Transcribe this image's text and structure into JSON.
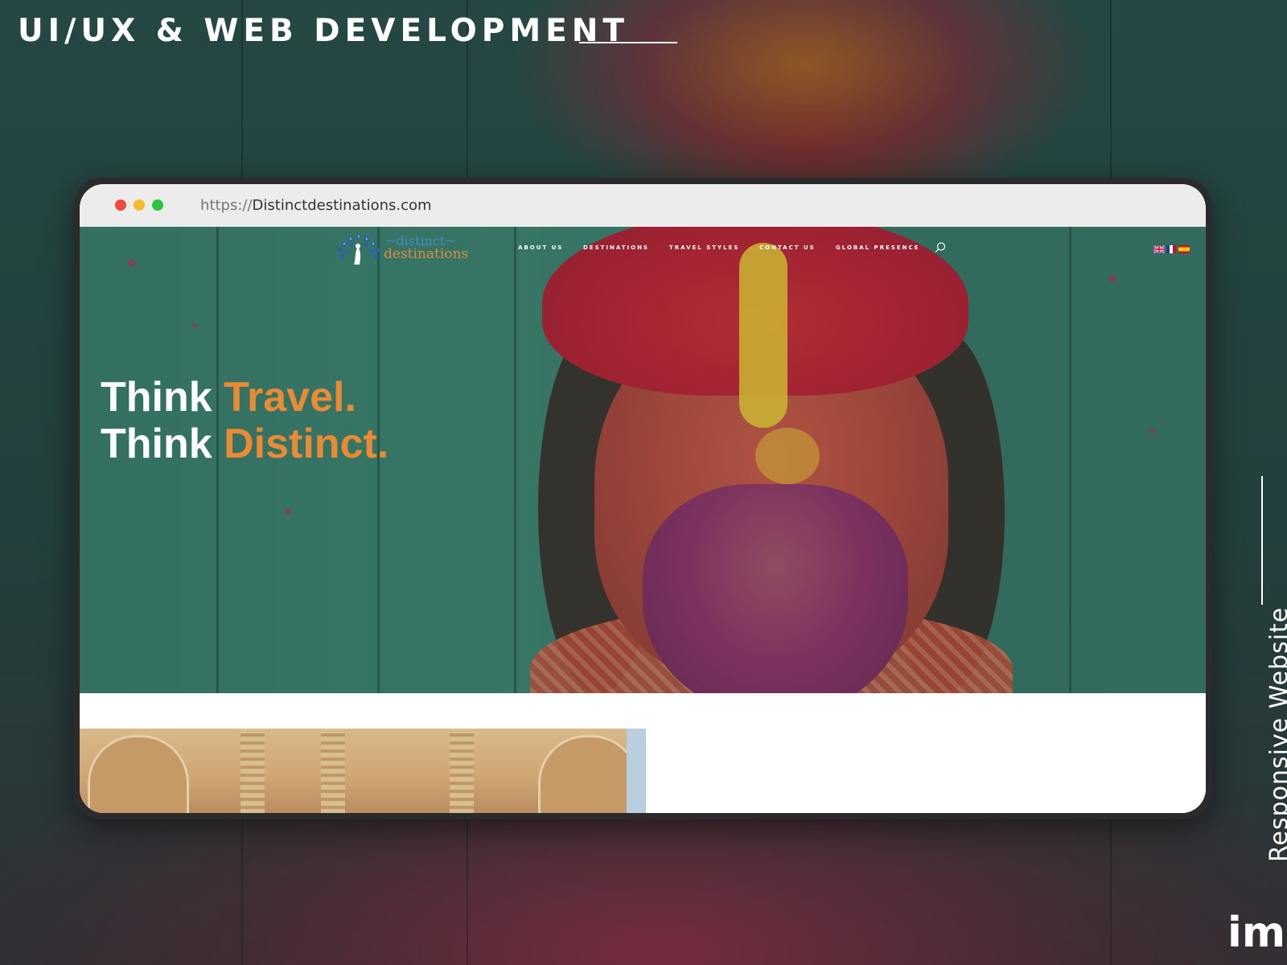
{
  "slide": {
    "headline": "UI/UX & WEB DEVELOPMENT",
    "side_label": "Responsive Website",
    "brand_mark": "im"
  },
  "browser": {
    "url_protocol": "https://",
    "url_host": "Distinctdestinations.com"
  },
  "site": {
    "logo_top": "~distinct~",
    "logo_bottom": "destinations",
    "nav": [
      "ABOUT US",
      "DESTINATIONS",
      "TRAVEL STYLES",
      "CONTACT US",
      "GLOBAL PRESENCE"
    ],
    "search_icon": "search-icon",
    "languages": [
      "uk-flag-icon",
      "france-flag-icon",
      "spain-flag-icon"
    ],
    "hero": {
      "line1_white": "Think",
      "line1_orange": "Travel.",
      "line2_white": "Think",
      "line2_orange": "Distinct."
    }
  },
  "colors": {
    "accent_orange": "#e98a34",
    "logo_blue": "#4a88c7",
    "dot_red": "#ee4b42",
    "dot_yellow": "#f5bb2b",
    "dot_green": "#2bc640"
  }
}
